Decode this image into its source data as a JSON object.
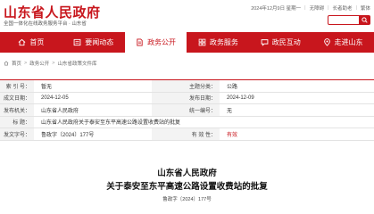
{
  "header": {
    "site_title": "山东省人民政府",
    "site_subtitle": "全国一体化在线政务服务平台 · 山东省",
    "date": "2024年12月9日 星期一",
    "links": [
      "无障碍",
      "长者助老",
      "繁体"
    ],
    "search_placeholder": ""
  },
  "nav": {
    "items": [
      {
        "label": "首页",
        "icon": "home-icon",
        "active": false
      },
      {
        "label": "要闻动态",
        "icon": "news-icon",
        "active": false
      },
      {
        "label": "政务公开",
        "icon": "document-icon",
        "active": true
      },
      {
        "label": "政务服务",
        "icon": "service-icon",
        "active": false
      },
      {
        "label": "政民互动",
        "icon": "chat-icon",
        "active": false
      },
      {
        "label": "走进山东",
        "icon": "map-icon",
        "active": false
      }
    ]
  },
  "breadcrumb": [
    "首页",
    "政务公开",
    "山东省政策文件库"
  ],
  "info": {
    "index_label": "索 引 号：",
    "index_value": "暂无",
    "topic_label": "主题分类：",
    "topic_value": "公路",
    "date_label": "成文日期：",
    "date_value": "2024-12-05",
    "pub_date_label": "发布日期：",
    "pub_date_value": "2024-12-09",
    "issuer_label": "发布机关：",
    "issuer_value": "山东省人民政府",
    "unified_label": "统一编号：",
    "unified_value": "无",
    "title_label": "标  题：",
    "title_value": "山东省人民政府关于泰安至东平高速公路设置收费站的批复",
    "docno_label": "发文字号：",
    "docno_value": "鲁政字〔2024〕177号",
    "validity_label": "有 效 性：",
    "validity_value": "有效"
  },
  "document": {
    "org": "山东省人民政府",
    "title": "关于泰安至东平高速公路设置收费站的批复",
    "number": "鲁政字〔2024〕177号"
  },
  "colors": {
    "brand_red": "#c8161d"
  }
}
